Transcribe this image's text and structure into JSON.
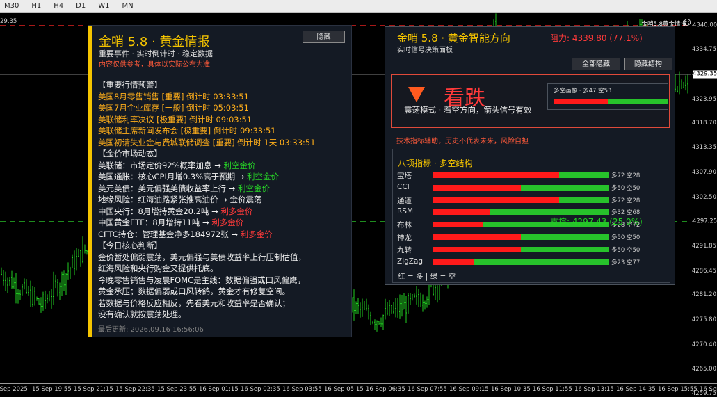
{
  "toolbar": {
    "timeframes": [
      "M30",
      "H1",
      "H4",
      "D1",
      "W1",
      "MN"
    ]
  },
  "chart": {
    "symbol_title": "金哨5.8黄金情报",
    "top_left_price": "29.35",
    "price_min": 4262,
    "price_max": 4343,
    "price_ticks": [
      "4340.00",
      "4334.75",
      "4329.35",
      "4323.95",
      "4318.70",
      "4313.35",
      "4307.90",
      "4302.50",
      "4297.25",
      "4291.85",
      "4286.45",
      "4281.20",
      "4275.80",
      "4270.40",
      "4265.00",
      "4259.75"
    ],
    "current_price": "4329.35",
    "resistance_price": "4340.00",
    "support_price": "4297.25",
    "time_labels": [
      "15 Sep 2025",
      "15 Sep 19:55",
      "15 Sep 21:15",
      "15 Sep 22:35",
      "15 Sep 23:55",
      "16 Sep 01:15",
      "16 Sep 02:35",
      "16 Sep 03:55",
      "16 Sep 05:15",
      "16 Sep 06:35",
      "16 Sep 07:55",
      "16 Sep 09:15",
      "16 Sep 10:35",
      "16 Sep 11:55",
      "16 Sep 13:15",
      "16 Sep 14:35",
      "16 Sep 15:55",
      "16 Sep 17:15"
    ],
    "colors": {
      "bull": "#22d022",
      "bear": "#22d022",
      "resistance": "#e02020",
      "support": "#22a022",
      "bid": "#808080"
    }
  },
  "left_panel": {
    "title": "金哨 5.8 · 黄金情报",
    "subtitle": "重要事件 · 实时倒计时 · 稳定数据",
    "warning": "内容仅供参考，具体以实际公布为准",
    "hide_button": "隐藏",
    "lines": [
      {
        "kind": "hdr",
        "text": "【重要行情预警】"
      },
      {
        "kind": "orange",
        "text": "美国8月零售销售 [重要] 倒计时 03:33:51"
      },
      {
        "kind": "orange",
        "text": "美国7月企业库存 [一般] 倒计时 05:03:51"
      },
      {
        "kind": "orange",
        "text": "美联储利率决议 [极重要] 倒计时 09:03:51"
      },
      {
        "kind": "orange",
        "text": "美联储主席新闻发布会 [极重要] 倒计时 09:33:51"
      },
      {
        "kind": "orange",
        "text": "美国初请失业金与费城联储调查 [重要] 倒计时 1天 03:33:51"
      },
      {
        "kind": "hdr",
        "text": "【金价市场动态】"
      },
      {
        "kind": "white",
        "text": "美联储：市场定价92%概率加息 → ",
        "tag": "利空金价",
        "tagc": "g"
      },
      {
        "kind": "white",
        "text": "美国通胀：核心CPI月增0.3%高于预期 → ",
        "tag": "利空金价",
        "tagc": "g"
      },
      {
        "kind": "white",
        "text": "美元美债：美元偏强美债收益率上行 → ",
        "tag": "利空金价",
        "tagc": "g"
      },
      {
        "kind": "white",
        "text": "地缘风险：红海油路紧张推高油价 → 金价震荡"
      },
      {
        "kind": "white",
        "text": "中国央行：8月增持黄金20.2吨 → ",
        "tag": "利多金价",
        "tagc": "r"
      },
      {
        "kind": "white",
        "text": "中国黄金ETF：8月增持11吨 → ",
        "tag": "利多金价",
        "tagc": "r"
      },
      {
        "kind": "white",
        "text": "CFTC持仓：管理基金净多184972张 → ",
        "tag": "利多金价",
        "tagc": "r"
      },
      {
        "kind": "hdr",
        "text": "【今日核心判断】"
      },
      {
        "kind": "white",
        "text": "金价暂处偏弱震荡，美元偏强与美债收益率上行压制估值，"
      },
      {
        "kind": "white",
        "text": "红海风险和央行购金又提供托底。"
      },
      {
        "kind": "white",
        "text": "今晚零售销售与凌晨FOMC是主线：数据偏强或口风偏鹰，"
      },
      {
        "kind": "white",
        "text": "黄金承压；数据偏弱或口风转鸽，黄金才有修复空间。"
      },
      {
        "kind": "white",
        "text": "若数据与价格反应相反，先看美元和收益率是否确认；"
      },
      {
        "kind": "white",
        "text": "没有确认就按震荡处理。"
      }
    ],
    "footer": "最后更新: 2026.09.16 16:56:06"
  },
  "right_panel": {
    "title": "金哨 5.8 · 黄金智能方向",
    "subtitle": "实时信号决策面板",
    "resistance_text": "阻力: 4339.80 (77.1%)",
    "btn_hide_all": "全部隐藏",
    "btn_hide_struct": "隐藏结构",
    "signal_word": "看跌",
    "signal_desc": "震荡模式 · 着空方向，箭头信号有效",
    "mini_label": "多空画像 · 多47 空53",
    "mini_bull": 47,
    "mini_bear": 53,
    "note": "技术指标辅助，历史不代表未来，风险自担",
    "indicators_title": "八项指标 · 多空结构",
    "indicators": [
      {
        "name": "宝塔",
        "bull": 72,
        "bear": 28,
        "label": "多72 空28"
      },
      {
        "name": "CCI",
        "bull": 50,
        "bear": 50,
        "label": "多50 空50"
      },
      {
        "name": "通道",
        "bull": 72,
        "bear": 28,
        "label": "多72 空28"
      },
      {
        "name": "RSM",
        "bull": 32,
        "bear": 68,
        "label": "多32 空68"
      },
      {
        "name": "布林",
        "bull": 28,
        "bear": 72,
        "label": "多28 空72"
      },
      {
        "name": "神龙",
        "bull": 50,
        "bear": 50,
        "label": "多50 空50"
      },
      {
        "name": "九转",
        "bull": 50,
        "bear": 50,
        "label": "多50 空50"
      },
      {
        "name": "ZigZag",
        "bull": 23,
        "bear": 77,
        "label": "多23 空77"
      }
    ],
    "legend": "红 = 多  |  绿 = 空",
    "support_text": "支撑: 4297.43 (25.0%)"
  }
}
